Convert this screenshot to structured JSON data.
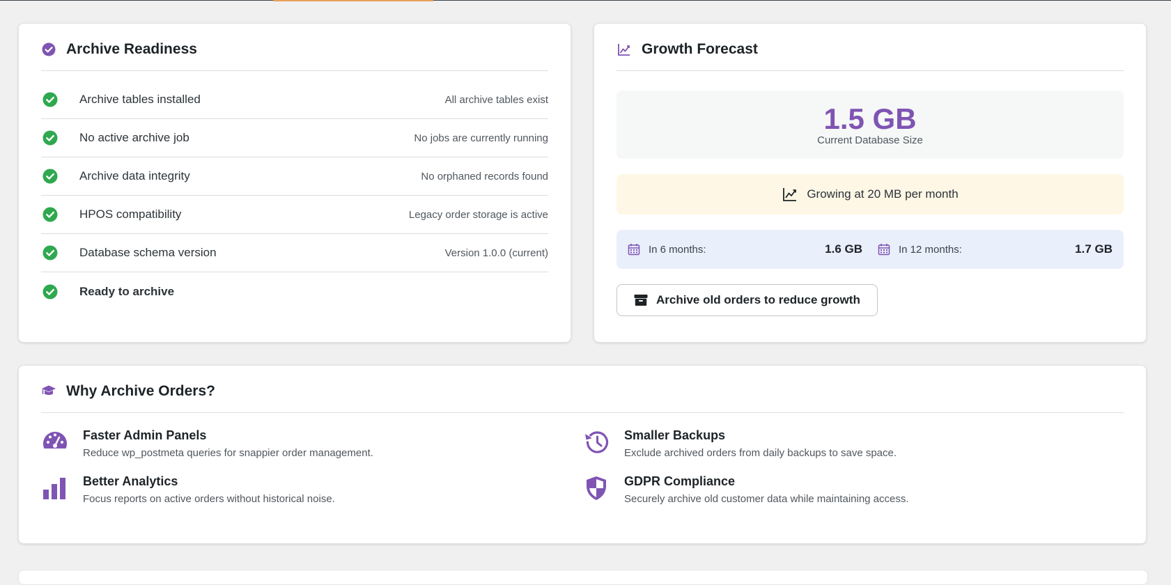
{
  "colors": {
    "accent": "#7f54b3",
    "success": "#2fa84f",
    "growth_bg": "#fef7e6",
    "projection_bg": "#e9effb"
  },
  "readiness": {
    "title": "Archive Readiness",
    "icon": "check-circle-icon",
    "checks": [
      {
        "label": "Archive tables installed",
        "detail": "All archive tables exist"
      },
      {
        "label": "No active archive job",
        "detail": "No jobs are currently running"
      },
      {
        "label": "Archive data integrity",
        "detail": "No orphaned records found"
      },
      {
        "label": "HPOS compatibility",
        "detail": "Legacy order storage is active"
      },
      {
        "label": "Database schema version",
        "detail": "Version 1.0.0 (current)"
      },
      {
        "label": "Ready to archive",
        "detail": ""
      }
    ]
  },
  "forecast": {
    "title": "Growth Forecast",
    "icon": "chart-line-icon",
    "current_size": "1.5 GB",
    "current_size_caption": "Current Database Size",
    "growth_text": "Growing at 20 MB per month",
    "projections": [
      {
        "label": "In 6 months:",
        "value": "1.6 GB"
      },
      {
        "label": "In 12 months:",
        "value": "1.7 GB"
      }
    ],
    "archive_button": "Archive old orders to reduce growth"
  },
  "why": {
    "title": "Why Archive Orders?",
    "icon": "graduation-cap-icon",
    "benefits": [
      {
        "title": "Faster Admin Panels",
        "desc": "Reduce wp_postmeta queries for snappier order management.",
        "icon": "dashboard-gauge-icon"
      },
      {
        "title": "Smaller Backups",
        "desc": "Exclude archived orders from daily backups to save space.",
        "icon": "backup-history-icon"
      },
      {
        "title": "Better Analytics",
        "desc": "Focus reports on active orders without historical noise.",
        "icon": "bar-chart-icon"
      },
      {
        "title": "GDPR Compliance",
        "desc": "Securely archive old customer data while maintaining access.",
        "icon": "shield-icon"
      }
    ]
  }
}
